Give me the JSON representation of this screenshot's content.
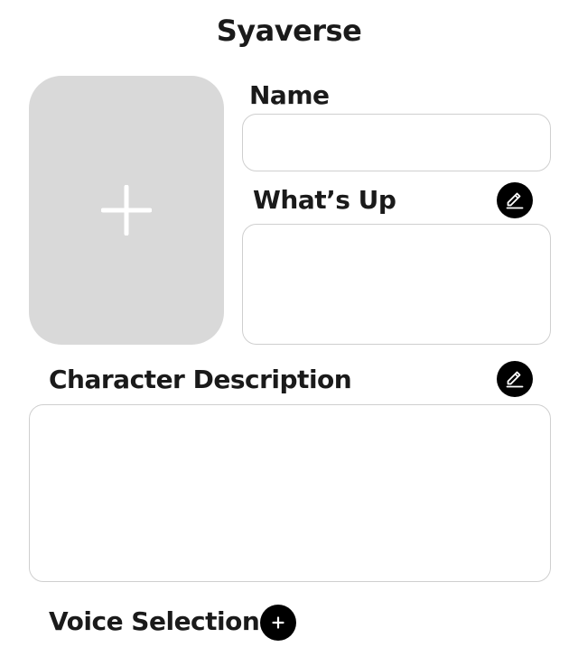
{
  "app": {
    "title": "Syaverse"
  },
  "avatar_upload": {
    "icon": "plus-icon"
  },
  "name_field": {
    "label": "Name",
    "value": "",
    "placeholder": ""
  },
  "whats_up_field": {
    "label": "What’s Up",
    "value": "",
    "placeholder": "",
    "edit_icon": "pencil-icon"
  },
  "description_field": {
    "label": "Character Description",
    "value": "",
    "placeholder": "",
    "edit_icon": "pencil-icon"
  },
  "voice_selection": {
    "label": "Voice Selection",
    "add_icon": "plus-icon"
  },
  "colors": {
    "background": "#ffffff",
    "placeholder_fill": "#d9d9d9",
    "border": "#cfcfcf",
    "button": "#000000",
    "text": "#1a1a1a"
  }
}
